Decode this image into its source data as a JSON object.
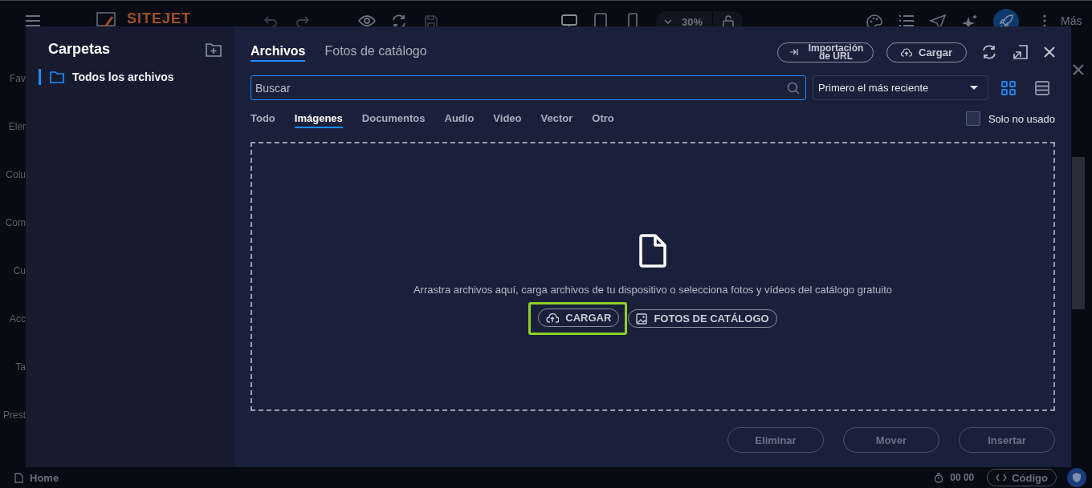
{
  "topbar": {
    "logo": "SITEJET",
    "zoom": "30%",
    "more": "Más"
  },
  "rail": {
    "items": [
      {
        "label": "Fav"
      },
      {
        "label": "Eler"
      },
      {
        "label": "Colu"
      },
      {
        "label": "Com"
      },
      {
        "label": "Cu"
      },
      {
        "label": "Acc"
      },
      {
        "label": "Ta"
      },
      {
        "label": "Prest"
      }
    ]
  },
  "dialog": {
    "folders": {
      "title": "Carpetas",
      "items": [
        {
          "label": "Todos los archivos",
          "selected": true
        }
      ]
    },
    "tabs": [
      {
        "label": "Archivos",
        "selected": true
      },
      {
        "label": "Fotos de catálogo",
        "selected": false
      }
    ],
    "actions": {
      "url_import": "Importación de URL",
      "upload": "Cargar"
    },
    "search": {
      "placeholder": "Buscar"
    },
    "sort": {
      "value": "Primero el más reciente"
    },
    "views": [
      {
        "kind": "grid",
        "selected": true
      },
      {
        "kind": "list",
        "selected": false
      }
    ],
    "filters": [
      {
        "label": "Todo",
        "selected": false
      },
      {
        "label": "Imágenes",
        "selected": true
      },
      {
        "label": "Documentos",
        "selected": false
      },
      {
        "label": "Audio",
        "selected": false
      },
      {
        "label": "Video",
        "selected": false
      },
      {
        "label": "Vector",
        "selected": false
      },
      {
        "label": "Otro",
        "selected": false
      }
    ],
    "unused_only": {
      "label": "Solo no usado",
      "checked": false
    },
    "dropzone": {
      "message": "Arrastra archivos aquí, carga archivos de tu dispositivo o selecciona fotos y vídeos del catálogo gratuito",
      "buttons": [
        {
          "kind": "upload",
          "label": "CARGAR",
          "highlighted": true
        },
        {
          "kind": "catalog",
          "label": "FOTOS DE CATÁLOGO",
          "highlighted": false
        }
      ]
    },
    "footer_buttons": [
      {
        "label": "Eliminar",
        "disabled": true
      },
      {
        "label": "Mover",
        "disabled": true
      },
      {
        "label": "Insertar",
        "disabled": true
      }
    ]
  },
  "statusbar": {
    "page": "Home",
    "time": "00 00",
    "code": "Código"
  }
}
